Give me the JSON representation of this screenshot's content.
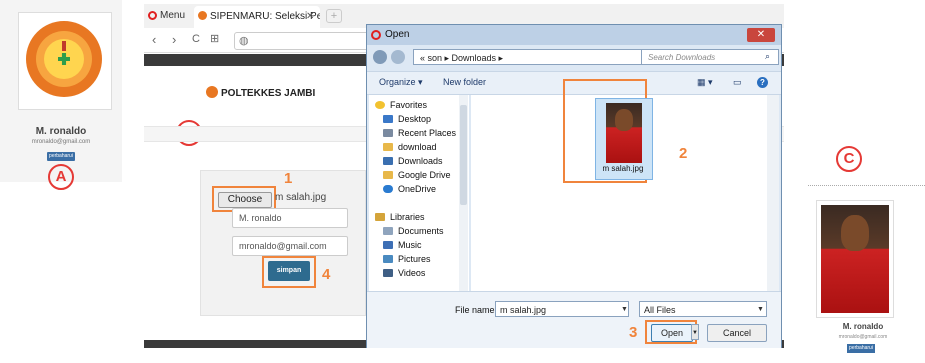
{
  "panel_a": {
    "label": "A",
    "logo_text": "POLITEKNIK KESEHATAN JAMBI",
    "name": "M. ronaldo",
    "email": "mronaldo@gmail.com",
    "badge": "perbaharui"
  },
  "browser": {
    "menu_label": "Menu",
    "tab_title": "SIPENMARU: Seleksi Pener",
    "tab_close": "✕",
    "nav": {
      "back": "‹",
      "forward": "›",
      "reload": "C",
      "grid": "⊞",
      "globe": "◍"
    },
    "site_title": "POLTEKKES JAMBI",
    "label": "B",
    "form": {
      "choose_file": "Choose File",
      "chosen_file": "m salah.jpg",
      "name_value": "M. ronaldo",
      "email_value": "mronaldo@gmail.com",
      "submit": "simpan"
    }
  },
  "dialog": {
    "title": "Open",
    "close": "✕",
    "breadcrumb": "« son ▸ Downloads ▸",
    "search_placeholder": "Search Downloads",
    "toolbar": {
      "organize": "Organize ▾",
      "new_folder": "New folder"
    },
    "nav_items": [
      {
        "label": "Favorites",
        "icon": "star-icon",
        "color": "#f2c230"
      },
      {
        "label": "Desktop",
        "icon": "desktop-icon",
        "color": "#3a78c8"
      },
      {
        "label": "Recent Places",
        "icon": "recent-places-icon",
        "color": "#7a8aa0"
      },
      {
        "label": "download",
        "icon": "folder-icon",
        "color": "#e8b84a"
      },
      {
        "label": "Downloads",
        "icon": "downloads-icon",
        "color": "#3a6fb0"
      },
      {
        "label": "Google Drive",
        "icon": "google-drive-icon",
        "color": "#e8b84a"
      },
      {
        "label": "OneDrive",
        "icon": "onedrive-icon",
        "color": "#2a7bd0"
      },
      {
        "label": "Libraries",
        "icon": "libraries-icon",
        "color": "#d4a43a"
      },
      {
        "label": "Documents",
        "icon": "documents-icon",
        "color": "#8fa4bd"
      },
      {
        "label": "Music",
        "icon": "music-icon",
        "color": "#3d6fb5"
      },
      {
        "label": "Pictures",
        "icon": "pictures-icon",
        "color": "#4a8ac0"
      },
      {
        "label": "Videos",
        "icon": "videos-icon",
        "color": "#3f5f85"
      }
    ],
    "file": {
      "name": "m salah.jpg"
    },
    "file_name_label": "File name:",
    "file_name_value": "m salah.jpg",
    "filter": "All Files",
    "open_button": "Open",
    "cancel_button": "Cancel"
  },
  "steps": {
    "one": "1",
    "two": "2",
    "three": "3",
    "four": "4"
  },
  "panel_c": {
    "label": "C",
    "name": "M. ronaldo",
    "email": "mronaldo@gmail.com",
    "badge": "perbaharui"
  },
  "colors": {
    "accent_orange": "#f0843c",
    "marker_red": "#e53935",
    "button_blue": "#2e6b8f"
  }
}
